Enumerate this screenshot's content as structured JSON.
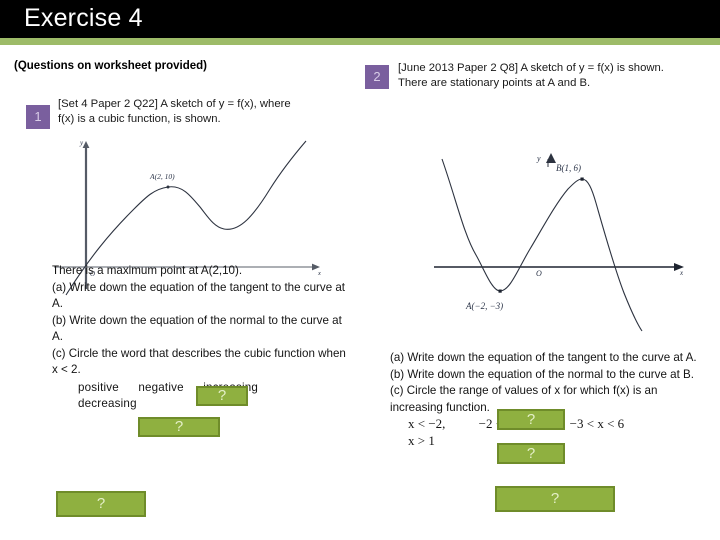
{
  "header": {
    "title": "Exercise 4",
    "bar_color": "#000000",
    "rule_color": "#9dbb68",
    "title_color": "#ffffff"
  },
  "colors": {
    "badge_bg": "#7a5f9e",
    "badge_fg": "#d9cde8",
    "answer_fill": "#8fb040",
    "answer_border": "#6f8c2a",
    "answer_mark": "#e4efc7"
  },
  "worksheet_note": "(Questions on worksheet provided)",
  "answer_placeholder": "?",
  "questions": [
    {
      "number": "1",
      "prompt_line1": "[Set 4 Paper 2 Q22] A sketch of y = f(x), where",
      "prompt_line2": "f(x) is a cubic function, is shown.",
      "figure": {
        "origin_label": "O",
        "x_axis_label": "x",
        "y_axis_label": "y",
        "points": [
          {
            "name": "A",
            "label": "A(2, 10)",
            "x": 2,
            "y": 10,
            "type": "maximum"
          }
        ]
      },
      "body": {
        "intro": "There is a maximum point at A(2,10).",
        "part_a": "(a) Write down the equation of the tangent to the curve at A.",
        "part_b": "(b) Write down the equation of the normal to the curve at A.",
        "part_c": "(c) Circle the word that describes the cubic function when x < 2.",
        "options": [
          "positive",
          "negative",
          "increasing",
          "decreasing"
        ]
      }
    },
    {
      "number": "2",
      "prompt_line1": "[June 2013 Paper 2 Q8] A sketch of y = f(x) is shown.",
      "prompt_line2": "There are stationary points at A and B.",
      "figure": {
        "origin_label": "O",
        "x_axis_label": "x",
        "y_axis_label": "y",
        "points": [
          {
            "name": "A",
            "label": "A(−2, −3)",
            "x": -2,
            "y": -3,
            "type": "minimum"
          },
          {
            "name": "B",
            "label": "B(1, 6)",
            "x": 1,
            "y": 6,
            "type": "maximum"
          }
        ]
      },
      "body": {
        "part_a": "(a) Write down the equation of the tangent to the curve at A.",
        "part_b": "(b) Write down the equation of the normal to the curve at B.",
        "part_c": "(c) Circle the range of values of x for which f(x) is an increasing function.",
        "options": [
          "x < −2,",
          "−2 < x < 1,",
          "−3 < x < 6",
          "x > 1"
        ]
      }
    }
  ],
  "answer_boxes": [
    {
      "id": "q1-tangent-answer"
    },
    {
      "id": "q1-normal-answer"
    },
    {
      "id": "q1-circle-answer"
    },
    {
      "id": "q2-tangent-answer"
    },
    {
      "id": "q2-normal-answer"
    },
    {
      "id": "q2-circle-answer"
    }
  ]
}
